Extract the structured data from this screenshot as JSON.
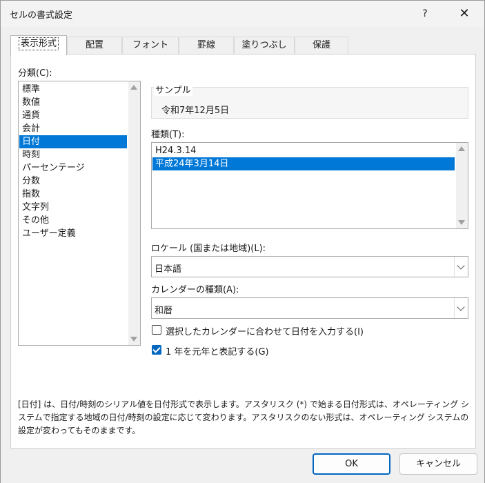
{
  "window": {
    "title": "セルの書式設定",
    "help": "?",
    "close": "✕"
  },
  "tabs": [
    {
      "label": "表示形式"
    },
    {
      "label": "配置"
    },
    {
      "label": "フォント"
    },
    {
      "label": "罫線"
    },
    {
      "label": "塗りつぶし"
    },
    {
      "label": "保護"
    }
  ],
  "category": {
    "label": "分類(C):",
    "items": [
      "標準",
      "数値",
      "通貨",
      "会計",
      "日付",
      "時刻",
      "パーセンテージ",
      "分数",
      "指数",
      "文字列",
      "その他",
      "ユーザー定義"
    ],
    "selected": "日付"
  },
  "sample": {
    "label": "サンプル",
    "value": "令和7年12月5日"
  },
  "type": {
    "label": "種類(T):",
    "items": [
      "H24.3.14",
      "平成24年3月14日"
    ],
    "selected": "平成24年3月14日"
  },
  "locale": {
    "label": "ロケール (国または地域)(L):",
    "value": "日本語"
  },
  "calendar": {
    "label": "カレンダーの種類(A):",
    "value": "和暦"
  },
  "checkbox_input": {
    "label": "選択したカレンダーに合わせて日付を入力する(I)",
    "checked": false
  },
  "checkbox_gannen": {
    "label": "1 年を元年と表記する(G)",
    "checked": true
  },
  "description": "[日付] は、日付/時刻のシリアル値を日付形式で表示します。アスタリスク (*) で始まる日付形式は、オペレーティング システムで指定する地域の日付/時刻の設定に応じて変わります。アスタリスクのない形式は、オペレーティング システムの設定が変わってもそのままです。",
  "buttons": {
    "ok": "OK",
    "cancel": "キャンセル"
  },
  "colors": {
    "selection": "#0078d7",
    "accent": "#0067c0"
  }
}
